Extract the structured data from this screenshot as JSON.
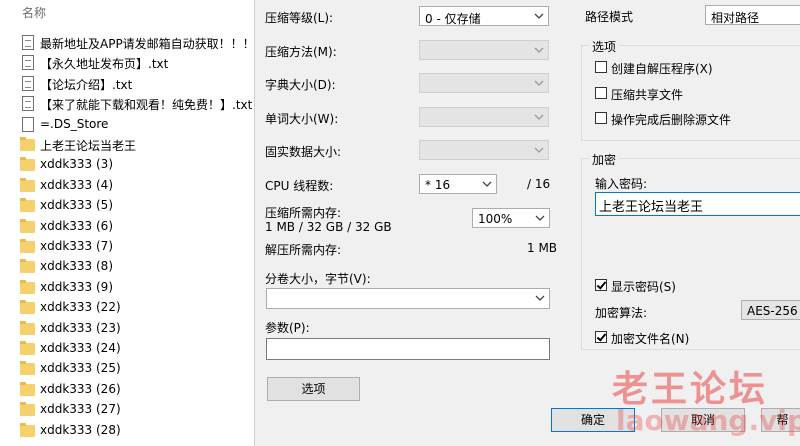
{
  "file_list": {
    "header": "名称",
    "items": [
      {
        "name": "最新地址及APP请发邮箱自动获取！！！.txt",
        "type": "txt"
      },
      {
        "name": "【永久地址发布页】.txt",
        "type": "txt"
      },
      {
        "name": "【论坛介绍】.txt",
        "type": "txt"
      },
      {
        "name": "【来了就能下载和观看！纯免费！】.txt",
        "type": "txt"
      },
      {
        "name": "=.DS_Store",
        "type": "file"
      },
      {
        "name": "上老王论坛当老王",
        "type": "folder"
      },
      {
        "name": "xddk333 (3)",
        "type": "folder"
      },
      {
        "name": "xddk333 (4)",
        "type": "folder"
      },
      {
        "name": "xddk333 (5)",
        "type": "folder"
      },
      {
        "name": "xddk333 (6)",
        "type": "folder"
      },
      {
        "name": "xddk333 (7)",
        "type": "folder"
      },
      {
        "name": "xddk333 (8)",
        "type": "folder"
      },
      {
        "name": "xddk333 (9)",
        "type": "folder"
      },
      {
        "name": "xddk333 (22)",
        "type": "folder"
      },
      {
        "name": "xddk333 (23)",
        "type": "folder"
      },
      {
        "name": "xddk333 (24)",
        "type": "folder"
      },
      {
        "name": "xddk333 (25)",
        "type": "folder"
      },
      {
        "name": "xddk333 (26)",
        "type": "folder"
      },
      {
        "name": "xddk333 (27)",
        "type": "folder"
      },
      {
        "name": "xddk333 (28)",
        "type": "folder"
      }
    ]
  },
  "dialog": {
    "compression_level": {
      "label": "压缩等级(L):",
      "value": "0 - 仅存储"
    },
    "compression_method": {
      "label": "压缩方法(M):"
    },
    "dictionary_size": {
      "label": "字典大小(D):"
    },
    "word_size": {
      "label": "单词大小(W):"
    },
    "solid_block_size": {
      "label": "固实数据大小:"
    },
    "cpu_threads": {
      "label": "CPU 线程数:",
      "value": "* 16",
      "max": "/ 16"
    },
    "memory_compress": {
      "label": "压缩所需内存:",
      "detail": "1 MB / 32 GB / 32 GB",
      "percent": "100%"
    },
    "memory_decompress": {
      "label": "解压所需内存:",
      "value": "1 MB"
    },
    "split_volume": {
      "label": "分卷大小，字节(V):",
      "value": ""
    },
    "parameters": {
      "label": "参数(P):",
      "value": ""
    },
    "options_button": "选项",
    "path_mode": {
      "label": "路径模式",
      "value": "相对路径"
    },
    "options_group": {
      "title": "选项",
      "items": [
        {
          "label": "创建自解压程序(X)",
          "checked": false
        },
        {
          "label": "压缩共享文件",
          "checked": false
        },
        {
          "label": "操作完成后删除源文件",
          "checked": false
        }
      ]
    },
    "encryption_group": {
      "title": "加密",
      "password_label": "输入密码:",
      "password_value": "上老王论坛当老王",
      "show_password": {
        "label": "显示密码(S)",
        "checked": true
      },
      "method_label": "加密算法:",
      "method_value": "AES-256",
      "encrypt_names": {
        "label": "加密文件名(N)",
        "checked": true
      }
    },
    "ok_button": "确定",
    "cancel_button": "取消",
    "help_button": "帮"
  },
  "watermark": {
    "title": "老王论坛",
    "url": "laowang.vip"
  }
}
